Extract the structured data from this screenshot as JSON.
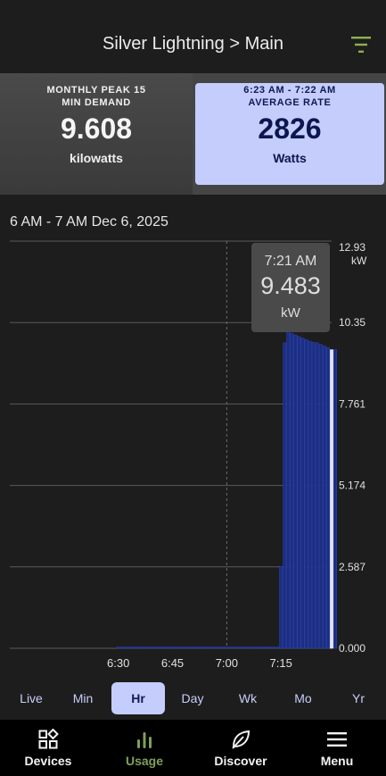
{
  "header": {
    "title": "Silver Lightning > Main",
    "filter_icon": "filter-list-icon"
  },
  "stats": {
    "left": {
      "label_line1": "MONTHLY PEAK 15",
      "label_line2": "MIN DEMAND",
      "value": "9.608",
      "unit": "kilowatts"
    },
    "right": {
      "label_line1": "6:23 AM - 7:22 AM",
      "label_line2": "AVERAGE RATE",
      "value": "2826",
      "unit": "Watts"
    }
  },
  "range_label": "6 AM - 7 AM Dec 6, 2025",
  "tooltip": {
    "time": "7:21 AM",
    "value": "9.483",
    "unit": "kW"
  },
  "chart_data": {
    "type": "bar",
    "x_unit": "minute after 6:00 AM",
    "x": [
      0,
      1,
      2,
      3,
      4,
      5,
      6,
      7,
      8,
      9,
      10,
      11,
      12,
      13,
      14,
      15,
      16,
      17,
      18,
      19,
      20,
      21,
      22,
      23,
      24,
      25,
      26,
      27,
      28,
      29,
      30,
      31,
      32,
      33,
      34,
      35,
      36,
      37,
      38,
      39,
      40,
      41,
      42,
      43,
      44,
      45,
      46,
      47,
      48,
      49,
      50,
      51,
      52,
      53,
      54,
      55,
      56,
      57,
      58,
      59,
      60
    ],
    "values": [
      0.04,
      0.04,
      0.04,
      0.04,
      0.04,
      0.04,
      0.04,
      0.04,
      0.04,
      0.04,
      0.04,
      0.04,
      0.04,
      0.04,
      0.04,
      0.04,
      0.04,
      0.04,
      0.04,
      0.04,
      0.04,
      0.04,
      0.04,
      0.04,
      0.04,
      0.04,
      0.04,
      0.04,
      0.04,
      0.04,
      0.0,
      0.04,
      0.04,
      0.04,
      0.04,
      0.04,
      0.04,
      0.04,
      0.04,
      0.04,
      0.04,
      0.04,
      0.04,
      0.04,
      0.04,
      2.6,
      9.7,
      10.25,
      10.0,
      9.95,
      9.9,
      9.85,
      9.8,
      9.75,
      9.72,
      9.7,
      9.65,
      9.6,
      9.55,
      9.483,
      9.483
    ],
    "highlight_index": 59,
    "y_unit": "kW",
    "y_ticks": [
      "0.000",
      "2.587",
      "5.174",
      "7.761",
      "10.35",
      "12.93"
    ],
    "ylim": [
      0,
      12.93
    ],
    "x_ticks": [
      {
        "label": "6:30",
        "x": 30
      },
      {
        "label": "6:45",
        "x": 45
      },
      {
        "label": "7:00",
        "x": 60
      },
      {
        "label": "7:15",
        "x": 75
      }
    ],
    "cursor_x": 60,
    "grid": true,
    "colors": {
      "bar": "#1b2e82",
      "bar_edge": "#2d45b8",
      "highlight": "#dfe4ff",
      "grid": "#5a5a5a"
    }
  },
  "range_tabs": [
    {
      "label": "Live",
      "active": false
    },
    {
      "label": "Min",
      "active": false
    },
    {
      "label": "Hr",
      "active": true
    },
    {
      "label": "Day",
      "active": false
    },
    {
      "label": "Wk",
      "active": false
    },
    {
      "label": "Mo",
      "active": false
    },
    {
      "label": "Yr",
      "active": false
    }
  ],
  "nav": [
    {
      "label": "Devices",
      "icon": "devices-grid-icon",
      "active": false
    },
    {
      "label": "Usage",
      "icon": "bar-chart-icon",
      "active": true
    },
    {
      "label": "Discover",
      "icon": "leaf-icon",
      "active": false
    },
    {
      "label": "Menu",
      "icon": "hamburger-menu-icon",
      "active": false
    }
  ],
  "colors": {
    "accent_active_nav": "#7fa05b",
    "card_highlight": "#c4cdfb"
  }
}
